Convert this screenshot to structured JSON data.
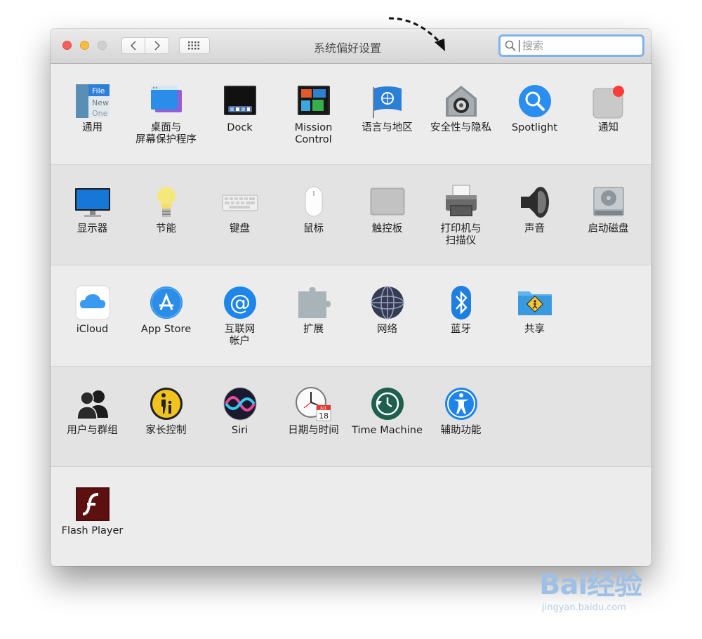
{
  "window": {
    "title": "系统偏好设置",
    "search": {
      "placeholder": "搜索"
    }
  },
  "sections": [
    [
      {
        "label": "通用",
        "icon": "general-icon"
      },
      {
        "label": "桌面与\n屏幕保护程序",
        "icon": "desktop-screensaver-icon"
      },
      {
        "label": "Dock",
        "icon": "dock-icon"
      },
      {
        "label": "Mission\nControl",
        "icon": "mission-control-icon"
      },
      {
        "label": "语言与地区",
        "icon": "language-region-icon"
      },
      {
        "label": "安全性与隐私",
        "icon": "security-privacy-icon"
      },
      {
        "label": "Spotlight",
        "icon": "spotlight-icon"
      },
      {
        "label": "通知",
        "icon": "notifications-icon"
      }
    ],
    [
      {
        "label": "显示器",
        "icon": "displays-icon"
      },
      {
        "label": "节能",
        "icon": "energy-saver-icon"
      },
      {
        "label": "键盘",
        "icon": "keyboard-icon"
      },
      {
        "label": "鼠标",
        "icon": "mouse-icon"
      },
      {
        "label": "触控板",
        "icon": "trackpad-icon"
      },
      {
        "label": "打印机与\n扫描仪",
        "icon": "printers-scanners-icon"
      },
      {
        "label": "声音",
        "icon": "sound-icon"
      },
      {
        "label": "启动磁盘",
        "icon": "startup-disk-icon"
      }
    ],
    [
      {
        "label": "iCloud",
        "icon": "icloud-icon"
      },
      {
        "label": "App Store",
        "icon": "app-store-icon"
      },
      {
        "label": "互联网\n帐户",
        "icon": "internet-accounts-icon"
      },
      {
        "label": "扩展",
        "icon": "extensions-icon"
      },
      {
        "label": "网络",
        "icon": "network-icon"
      },
      {
        "label": "蓝牙",
        "icon": "bluetooth-icon"
      },
      {
        "label": "共享",
        "icon": "sharing-icon"
      }
    ],
    [
      {
        "label": "用户与群组",
        "icon": "users-groups-icon"
      },
      {
        "label": "家长控制",
        "icon": "parental-controls-icon"
      },
      {
        "label": "Siri",
        "icon": "siri-icon"
      },
      {
        "label": "日期与时间",
        "icon": "date-time-icon"
      },
      {
        "label": "Time Machine",
        "icon": "time-machine-icon"
      },
      {
        "label": "辅助功能",
        "icon": "accessibility-icon"
      }
    ],
    [
      {
        "label": "Flash Player",
        "icon": "flash-player-icon"
      }
    ]
  ],
  "date_icon": {
    "month": "JUL",
    "day": "18"
  },
  "general_icon": {
    "line1": "File",
    "line2": "New",
    "line3": "One"
  },
  "watermark": {
    "main": "Bai经验",
    "sub": "jingyan.baidu.com"
  }
}
